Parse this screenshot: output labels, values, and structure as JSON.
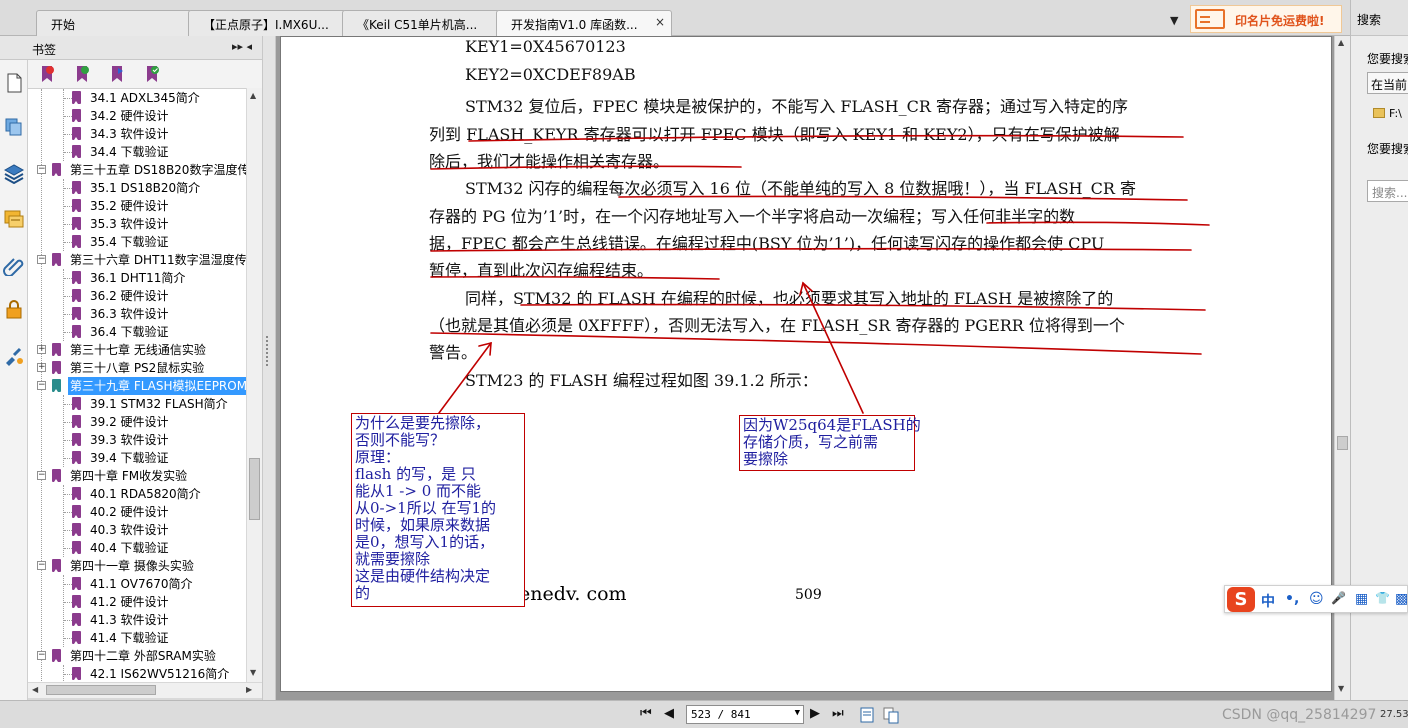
{
  "tabs": [
    {
      "label": "开始"
    },
    {
      "label": "【正点原子】I.MX6U..."
    },
    {
      "label": "《Keil C51单片机高..."
    },
    {
      "label": "开发指南V1.0 库函数..."
    }
  ],
  "tab_close_glyph": "×",
  "tab_dropdown_glyph": "▼",
  "ad_text": "印名片免运费啦!",
  "bookmark_panel": {
    "title": "书签",
    "collapse_glyph": "▸▸ ◂",
    "items": [
      {
        "label": "34.1 ADXL345简介",
        "level": 2
      },
      {
        "label": "34.2 硬件设计",
        "level": 2
      },
      {
        "label": "34.3 软件设计",
        "level": 2
      },
      {
        "label": "34.4 下载验证",
        "level": 2
      },
      {
        "label": "第三十五章  DS18B20数字温度传",
        "level": 1,
        "expanded": true
      },
      {
        "label": "35.1 DS18B20简介",
        "level": 2
      },
      {
        "label": "35.2 硬件设计",
        "level": 2
      },
      {
        "label": "35.3 软件设计",
        "level": 2
      },
      {
        "label": "35.4 下载验证",
        "level": 2
      },
      {
        "label": "第三十六章  DHT11数字温湿度传",
        "level": 1,
        "expanded": true
      },
      {
        "label": "36.1 DHT11简介",
        "level": 2
      },
      {
        "label": "36.2 硬件设计",
        "level": 2
      },
      {
        "label": "36.3 软件设计",
        "level": 2
      },
      {
        "label": "36.4 下载验证",
        "level": 2
      },
      {
        "label": "第三十七章  无线通信实验",
        "level": 1,
        "expanded": false
      },
      {
        "label": "第三十八章  PS2鼠标实验",
        "level": 1,
        "expanded": false
      },
      {
        "label": "第三十九章 FLASH模拟EEPROM实",
        "level": 1,
        "expanded": true,
        "selected": true
      },
      {
        "label": "39.1 STM32 FLASH简介",
        "level": 2
      },
      {
        "label": "39.2 硬件设计",
        "level": 2
      },
      {
        "label": "39.3 软件设计",
        "level": 2
      },
      {
        "label": "39.4 下载验证",
        "level": 2
      },
      {
        "label": "第四十章 FM收发实验",
        "level": 1,
        "expanded": true
      },
      {
        "label": "40.1 RDA5820简介",
        "level": 2
      },
      {
        "label": "40.2 硬件设计",
        "level": 2
      },
      {
        "label": "40.3 软件设计",
        "level": 2
      },
      {
        "label": "40.4 下载验证",
        "level": 2
      },
      {
        "label": "第四十一章 摄像头实验",
        "level": 1,
        "expanded": true
      },
      {
        "label": "41.1 OV7670简介",
        "level": 2
      },
      {
        "label": "41.2 硬件设计",
        "level": 2
      },
      {
        "label": "41.3 软件设计",
        "level": 2
      },
      {
        "label": "41.4 下载验证",
        "level": 2
      },
      {
        "label": "第四十二章 外部SRAM实验",
        "level": 1,
        "expanded": true
      },
      {
        "label": "42.1 IS62WV51216简介",
        "level": 2
      }
    ]
  },
  "document": {
    "lines": [
      "KEY1=0X45670123",
      "KEY2=0XCDEF89AB",
      "STM32 复位后，FPEC 模块是被保护的，不能写入 FLASH_CR 寄存器；通过写入特定的序",
      "列到 FLASH_KEYR 寄存器可以打开 FPEC 模块（即写入 KEY1 和 KEY2），只有在写保护被解",
      "除后，我们才能操作相关寄存器。",
      "STM32 闪存的编程每次必须写入 16 位（不能单纯的写入 8 位数据哦！），当 FLASH_CR 寄",
      "存器的 PG 位为’1’时，在一个闪存地址写入一个半字将启动一次编程；写入任何非半字的数",
      "据，FPEC 都会产生总线错误。在编程过程中(BSY 位为’1’)，任何读写闪存的操作都会使 CPU",
      "暂停，直到此次闪存编程结束。",
      "同样，STM32 的 FLASH 在编程的时候，也必须要求其写入地址的 FLASH 是被擦除了的",
      "（也就是其值必须是 0XFFFF），否则无法写入，在 FLASH_SR 寄存器的 PGERR 位将得到一个",
      "警告。",
      "STM23 的 FLASH 编程过程如图 39.1.2 所示："
    ],
    "footer_site": "enedv. com",
    "page_number": "509",
    "annotation_left": [
      "为什么是要先擦除，",
      "否则不能写？",
      "原理：",
      " flash  的写，是 只",
      "能从1 -> 0   而不能",
      "从0->1所以 在写1的",
      "时候，如果原来数据",
      "是0，想写入1的话，",
      "就需要擦除",
      "这是由硬件结构决定",
      "的"
    ],
    "annotation_right": [
      "因为W25q64是FLASH的",
      "存储介质，写之前需",
      "要擦除"
    ]
  },
  "search_panel": {
    "title": "搜索",
    "prompt1": "您要搜索",
    "scope": "在当前",
    "folder": "F:\\",
    "prompt2": "您要搜索",
    "placeholder": "搜索..."
  },
  "status_bar": {
    "page_indicator": "523 / 841",
    "nav_first": "⏮",
    "nav_prev": "◀",
    "nav_next": "▶",
    "nav_last": "⏭",
    "watermark": "CSDN @qq_25814297",
    "corner": "27.53"
  },
  "ime": {
    "logo": "S",
    "mode": "中",
    "punct": "•,",
    "emoji": "☺",
    "mic": "🎤",
    "keyboard": "▦",
    "shirt": "👕",
    "grid": "▩"
  },
  "colors": {
    "selection": "#3399ff",
    "annotation_border": "#c00000",
    "annotation_text": "#2020a0",
    "ink": "#c00000",
    "bookmark": "#8b3b8d",
    "ad": "#e0531b"
  },
  "icons": {
    "left_rail": [
      "page-thumbnail-icon",
      "layers-icon",
      "stack-icon",
      "comment-icon",
      "attachment-icon",
      "lock-icon",
      "sign-icon"
    ],
    "bookmark_toolbar": [
      "delete-bookmark-icon",
      "add-bookmark-icon",
      "expand-bookmark-icon",
      "properties-bookmark-icon"
    ]
  }
}
